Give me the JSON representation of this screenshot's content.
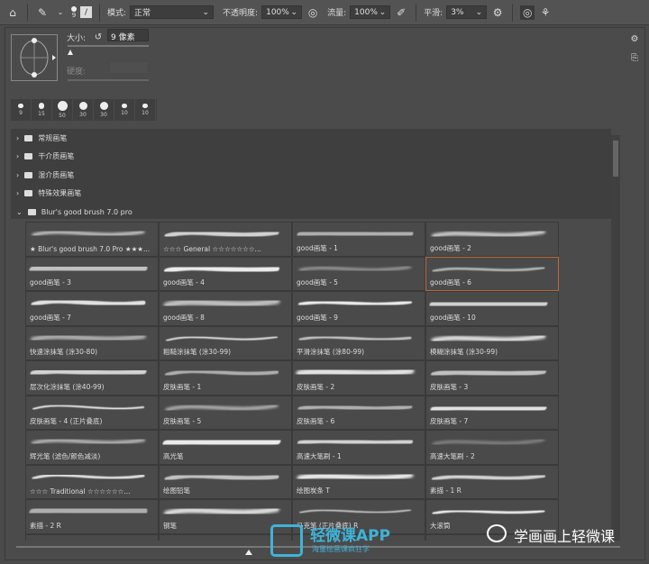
{
  "toolbar": {
    "brush_size": "9",
    "mode_label": "模式:",
    "mode_value": "正常",
    "opacity_label": "不透明度:",
    "opacity_value": "100%",
    "flow_label": "流量:",
    "flow_value": "100%",
    "smoothing_label": "平滑:",
    "smoothing_value": "3%"
  },
  "brush_panel": {
    "size_label": "大小:",
    "size_value": "9 像素",
    "hardness_label": "硬度:",
    "size_percent": 2,
    "presets": [
      "9",
      "15",
      "50",
      "30",
      "30",
      "10",
      "10"
    ],
    "folders": [
      {
        "label": "常规画笔",
        "expanded": false
      },
      {
        "label": "干介质画笔",
        "expanded": false
      },
      {
        "label": "湿介质画笔",
        "expanded": false
      },
      {
        "label": "特殊效果画笔",
        "expanded": false
      },
      {
        "label": "Blur's good brush 7.0 pro",
        "expanded": true
      }
    ],
    "brushes": [
      "★ Blur's good brush 7.0 Pro ★★★...",
      "☆☆☆ General ☆☆☆☆☆☆☆...",
      "good画笔 - 1",
      "good画笔 - 2",
      "good画笔 - 3",
      "good画笔 - 4",
      "good画笔 - 5",
      "good画笔 - 6",
      "good画笔 - 7",
      "good画笔 - 8",
      "good画笔 - 9",
      "good画笔 - 10",
      "快速涂抹笔 (涂30-80)",
      "粗糙涂抹笔 (涂30-99)",
      "平滑涂抹笔 (涂80-99)",
      "模糊涂抹笔 (涂30-99)",
      "层次化涂抹笔 (涂40-99)",
      "皮肤画笔 - 1",
      "皮肤画笔 - 2",
      "皮肤画笔 - 3",
      "皮肤画笔 - 4 (正片叠底)",
      "皮肤画笔 - 5",
      "皮肤画笔 - 6",
      "皮肤画笔 - 7",
      "辉光笔 (滤色/颜色减淡)",
      "高光笔",
      "高速大笔刷 - 1",
      "高速大笔刷 - 2",
      "☆☆☆ Traditional ☆☆☆☆☆☆...",
      "绘图铅笔",
      "绘图炭条 T",
      "素描 - 1 R",
      "素描 - 2 R",
      "钢笔",
      "马克笔 (正片叠底) R",
      "大滚筒",
      "",
      "",
      "",
      ""
    ],
    "selected_index": 7
  },
  "watermark": {
    "app_name": "轻微课APP",
    "app_slogan": "海量绘画课疯狂学",
    "account": "学画画上轻微课"
  }
}
